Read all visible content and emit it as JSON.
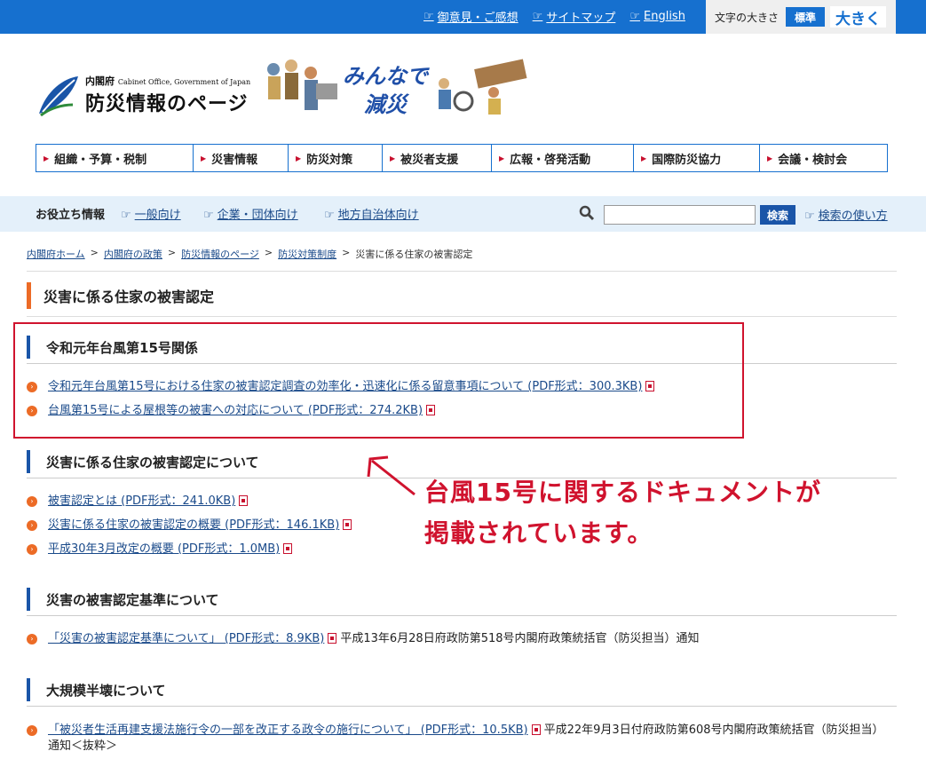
{
  "top": {
    "links": [
      "御意見・ご感想",
      "サイトマップ",
      "English"
    ],
    "font_label": "文字の大きさ",
    "font_standard": "標準",
    "font_large": "大きく"
  },
  "header": {
    "logo_sub": "内閣府",
    "logo_sub_en": "Cabinet Office, Government of Japan",
    "logo_main": "防災情報のページ",
    "banner_line1": "みんなで",
    "banner_line2": "減災"
  },
  "nav": [
    "組織・予算・税制",
    "災害情報",
    "防災対策",
    "被災者支援",
    "広報・啓発活動",
    "国際防災協力",
    "会議・検討会"
  ],
  "helper": {
    "title": "お役立ち情報",
    "links": [
      "一般向け",
      "企業・団体向け",
      "地方自治体向け"
    ],
    "search_button": "検索",
    "howto": "検索の使い方"
  },
  "breadcrumb": [
    "内閣府ホーム",
    "内閣府の政策",
    "防災情報のページ",
    "防災対策制度",
    "災害に係る住家の被害認定"
  ],
  "page_title": "災害に係る住家の被害認定",
  "sections": [
    {
      "title": "令和元年台風第15号関係",
      "items": [
        {
          "link": "令和元年台風第15号における住家の被害認定調査の効率化・迅速化に係る留意事項について (PDF形式：300.3KB)",
          "note": ""
        },
        {
          "link": "台風第15号による屋根等の被害への対応について (PDF形式：274.2KB)",
          "note": ""
        }
      ]
    },
    {
      "title": "災害に係る住家の被害認定について",
      "items": [
        {
          "link": "被害認定とは (PDF形式：241.0KB)",
          "note": ""
        },
        {
          "link": "災害に係る住家の被害認定の概要 (PDF形式：146.1KB)",
          "note": ""
        },
        {
          "link": "平成30年3月改定の概要 (PDF形式：1.0MB)",
          "note": ""
        }
      ]
    },
    {
      "title": "災害の被害認定基準について",
      "items": [
        {
          "link": "「災害の被害認定基準について」 (PDF形式：8.9KB)",
          "note": "平成13年6月28日府政防第518号内閣府政策統括官（防災担当）通知"
        }
      ]
    },
    {
      "title": "大規模半壊について",
      "items": [
        {
          "link": "「被災者生活再建支援法施行令の一部を改正する政令の施行について」 (PDF形式：10.5KB)",
          "note": "平成22年9月3日付府政防第608号内閣府政策統括官（防災担当）通知＜抜粋＞"
        }
      ]
    }
  ],
  "annotation": {
    "line1": "台風15号に関するドキュメントが",
    "line2": "掲載されています。"
  },
  "colors": {
    "brand": "#1670cf",
    "accent": "#ec6b26",
    "highlight": "#d0132e"
  }
}
